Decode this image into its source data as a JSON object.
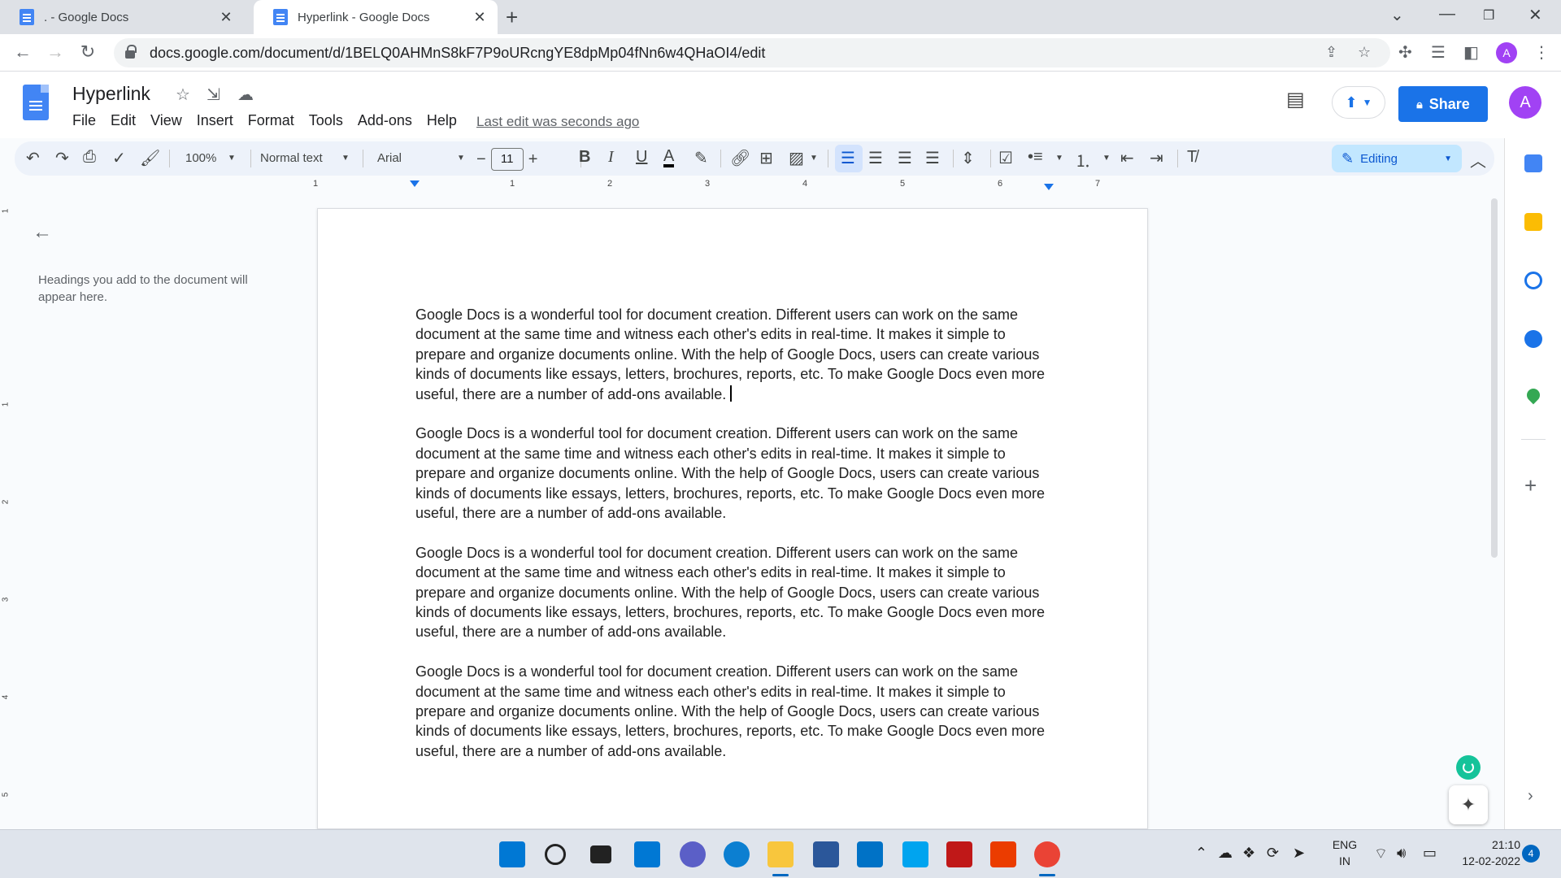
{
  "browser": {
    "tabs": [
      {
        "title": ". - Google Docs",
        "active": false
      },
      {
        "title": "Hyperlink - Google Docs",
        "active": true
      }
    ],
    "new_tab_icon": "plus-icon",
    "url": "docs.google.com/document/d/1BELQ0AHMnS8kF7P9oURcngYE8dpMp04fNn6w4QHaOI4/edit",
    "profile_initial": "A"
  },
  "docs": {
    "title": "Hyperlink",
    "menu": [
      "File",
      "Edit",
      "View",
      "Insert",
      "Format",
      "Tools",
      "Add-ons",
      "Help"
    ],
    "last_edit": "Last edit was seconds ago",
    "share_label": "Share",
    "avatar_initial": "A",
    "accent_color": "#1a73e8"
  },
  "toolbar": {
    "zoom": "100%",
    "style": "Normal text",
    "font": "Arial",
    "font_size": "11",
    "mode": "Editing"
  },
  "ruler": {
    "labels": [
      "1",
      "1",
      "2",
      "3",
      "4",
      "5",
      "6",
      "7"
    ]
  },
  "outline": {
    "hint": "Headings you add to the document will appear here."
  },
  "document": {
    "paragraphs": [
      "Google Docs is a wonderful tool for document creation. Different users can work on the same document at the same time and witness each other's edits in real-time. It makes it simple to prepare and organize documents online. With the help of Google Docs, users can create various kinds of documents like essays, letters, brochures, reports, etc. To make Google Docs even more useful, there are a number of add-ons available.",
      "Google Docs is a wonderful tool for document creation. Different users can work on the same document at the same time and witness each other's edits in real-time. It makes it simple to prepare and organize documents online. With the help of Google Docs, users can create various kinds of documents like essays, letters, brochures, reports, etc. To make Google Docs even more useful, there are a number of add-ons available.",
      "Google Docs is a wonderful tool for document creation. Different users can work on the same document at the same time and witness each other's edits in real-time. It makes it simple to prepare and organize documents online. With the help of Google Docs, users can create various kinds of documents like essays, letters, brochures, reports, etc. To make Google Docs even more useful, there are a number of add-ons available.",
      "Google Docs is a wonderful tool for document creation. Different users can work on the same document at the same time and witness each other's edits in real-time. It makes it simple to prepare and organize documents online. With the help of Google Docs, users can create various kinds of documents like essays, letters, brochures, reports, etc. To make Google Docs even more useful, there are a number of add-ons available."
    ]
  },
  "taskbar": {
    "language": "ENG",
    "region": "IN",
    "time": "21:10",
    "date": "12-02-2022",
    "notification_count": "4"
  }
}
